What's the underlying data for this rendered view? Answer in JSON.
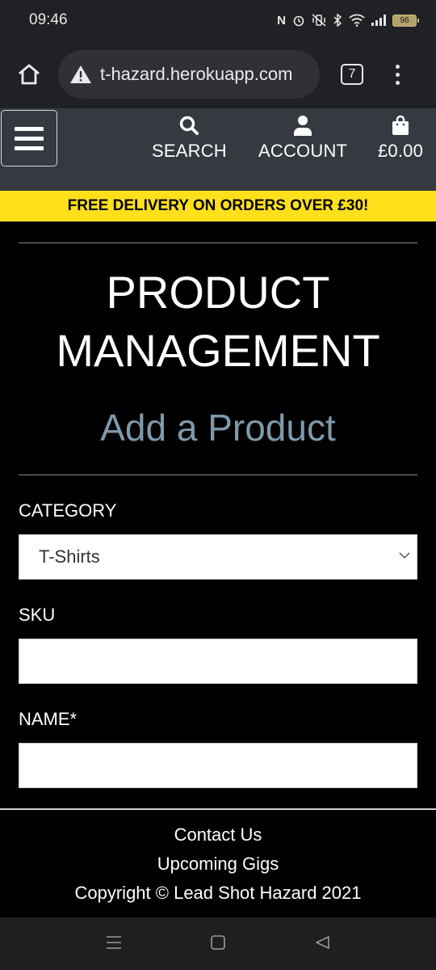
{
  "status_bar": {
    "time": "09:46",
    "battery": "96",
    "icons": [
      "nfc-icon",
      "alarm-icon",
      "vibrate-off-icon",
      "bluetooth-icon",
      "wifi-icon",
      "signal-icon",
      "battery-icon"
    ]
  },
  "browser": {
    "url": "t-hazard.herokuapp.com",
    "tab_count": "7",
    "icons": [
      "home-icon",
      "warning-icon",
      "tabs-icon",
      "more-icon"
    ]
  },
  "header": {
    "nav": [
      {
        "label": "SEARCH",
        "icon": "search-icon"
      },
      {
        "label": "ACCOUNT",
        "icon": "user-icon"
      },
      {
        "label": "£0.00",
        "icon": "shopping-bag-icon"
      }
    ],
    "menu_icon": "hamburger-icon",
    "background": "#343a40"
  },
  "banner": {
    "text": "FREE DELIVERY ON ORDERS OVER £30!",
    "color": "#ffe01b"
  },
  "main": {
    "title": "PRODUCT MANAGEMENT",
    "subtitle": "Add a Product",
    "subtitle_color": "#7d9aab",
    "fields": {
      "category": {
        "label": "CATEGORY",
        "value": "T-Shirts"
      },
      "sku": {
        "label": "SKU",
        "value": ""
      },
      "name": {
        "label": "NAME*",
        "value": ""
      }
    }
  },
  "footer": {
    "links": [
      "Contact Us",
      "Upcoming Gigs"
    ],
    "copyright": "Copyright © Lead Shot Hazard 2021"
  },
  "android_nav": [
    "recents-icon",
    "home-square-icon",
    "back-icon"
  ]
}
